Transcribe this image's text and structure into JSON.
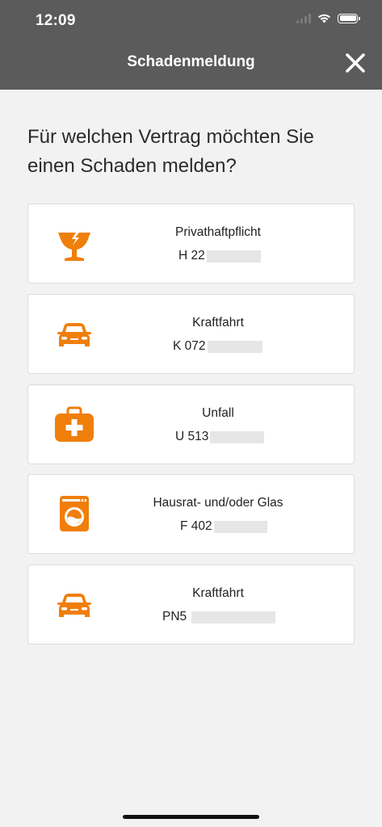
{
  "status_bar": {
    "time": "12:09"
  },
  "header": {
    "title": "Schadenmeldung",
    "close_icon": "close-icon"
  },
  "question": "Für welchen Vertrag möchten Sie einen Schaden melden?",
  "accent_color": "#f07e0a",
  "contracts": [
    {
      "label": "Privathaftpflicht",
      "number": "H 22",
      "icon": "broken-glass-icon"
    },
    {
      "label": "Kraftfahrt",
      "number": "K 072",
      "icon": "car-icon"
    },
    {
      "label": "Unfall",
      "number": "U 513",
      "icon": "first-aid-kit-icon"
    },
    {
      "label": "Hausrat- und/oder Glas",
      "number": "F 402",
      "icon": "washing-machine-icon"
    },
    {
      "label": "Kraftfahrt",
      "number": "PN5",
      "icon": "car-icon"
    }
  ]
}
